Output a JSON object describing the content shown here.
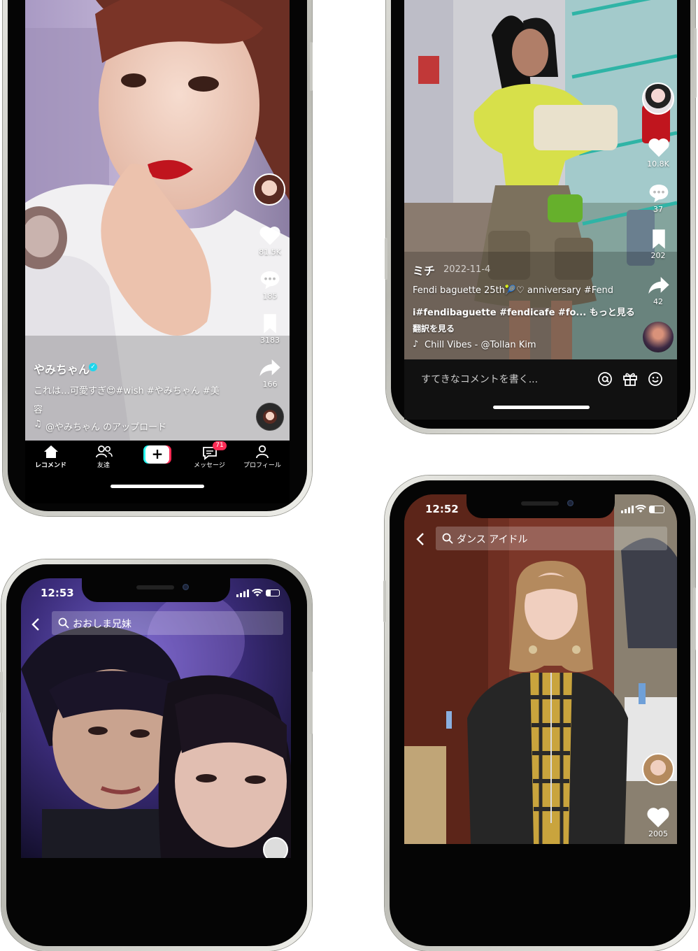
{
  "phone1": {
    "creator": "やみちゃん",
    "caption_line1": "これは…可愛すぎ😍#wish #やみちゃん #美",
    "caption_line2": "容",
    "sound": "@やみちゃん のアップロード",
    "likes": "81.5K",
    "comments": "185",
    "saves": "3183",
    "shares": "166",
    "nav": {
      "home": "レコメンド",
      "friends": "友達",
      "messages": "メッセージ",
      "messages_badge": "71",
      "profile": "プロフィール"
    }
  },
  "phone2": {
    "creator": "ミチ",
    "date": "2022-11-4",
    "caption_line1": "Fendi baguette 25th🎾♡ anniversary  #Fend",
    "caption_line2": "i#fendibaguette #fendicafe #fo... もっと見る",
    "translate": "翻訳を見る",
    "sound": "Chill Vibes - @Tollan Kim",
    "likes": "10.8K",
    "comments": "37",
    "saves": "202",
    "shares": "42",
    "comment_placeholder": "すてきなコメントを書く..."
  },
  "phone3": {
    "time": "12:53",
    "search_query": "おおしま兄妹"
  },
  "phone4": {
    "time": "12:52",
    "search_query": "ダンス アイドル",
    "likes": "2005"
  },
  "colors": {
    "accent_red": "#fe2c55",
    "accent_cyan": "#25f4ee",
    "verified_blue": "#20d5ec"
  }
}
